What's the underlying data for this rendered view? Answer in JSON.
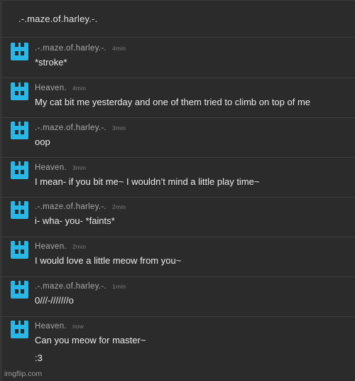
{
  "header": {
    "title": ".-.maze.of.harley.-."
  },
  "colors": {
    "background": "#2b2b2b",
    "avatar": "#2bb7e6",
    "text": "#ececec",
    "muted": "#a9a9a9"
  },
  "messages": [
    {
      "author": ".-.maze.of.harley.-.",
      "time": "4min",
      "text": "*stroke*"
    },
    {
      "author": "Heaven.",
      "time": "4min",
      "text": "My cat bit me yesterday and one of them tried to climb on top of me"
    },
    {
      "author": ".-.maze.of.harley.-.",
      "time": "3min",
      "text": "oop"
    },
    {
      "author": "Heaven.",
      "time": "3min",
      "text": "I mean- if you bit me~ I wouldn’t mind a little play time~"
    },
    {
      "author": ".-.maze.of.harley.-.",
      "time": "2min",
      "text": "i- wha- you- *faints*"
    },
    {
      "author": "Heaven.",
      "time": "2min",
      "text": "I would love a little meow from you~"
    },
    {
      "author": ".-.maze.of.harley.-.",
      "time": "1min",
      "text": "0///-///////o"
    },
    {
      "author": "Heaven.",
      "time": "now",
      "text": "Can you meow for master~",
      "text2": ":3"
    }
  ],
  "watermark": "imgflip.com",
  "icons": {
    "avatar": "discord-like-avatar-icon"
  }
}
